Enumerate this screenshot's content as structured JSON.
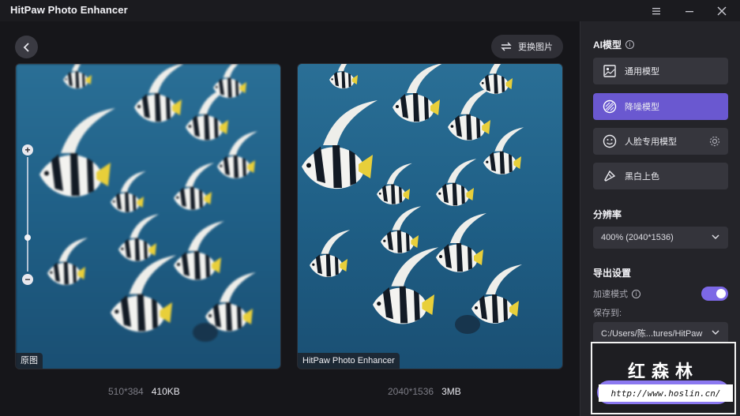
{
  "app": {
    "title": "HitPaw Photo Enhancer"
  },
  "toolbar": {
    "replace_label": "更换图片"
  },
  "images": {
    "original": {
      "tag": "原图",
      "dimensions": "510*384",
      "size": "410KB"
    },
    "enhanced": {
      "tag": "HitPaw Photo Enhancer",
      "dimensions": "2040*1536",
      "size": "3MB"
    }
  },
  "side": {
    "ai_model_title": "AI模型",
    "models": [
      {
        "label": "通用模型",
        "icon": "image-icon",
        "active": false
      },
      {
        "label": "降噪模型",
        "icon": "denoise-icon",
        "active": true
      },
      {
        "label": "人脸专用模型",
        "icon": "face-icon",
        "active": false
      },
      {
        "label": "黑白上色",
        "icon": "colorize-icon",
        "active": false
      }
    ],
    "resolution_title": "分辨率",
    "resolution_value": "400% (2040*1536)",
    "export_title": "导出设置",
    "accel_label": "加速模式",
    "accel_on": true,
    "saveto_label": "保存到:",
    "saveto_path": "C:/Users/陈...tures/HitPaw"
  },
  "watermark": {
    "title": "红森林",
    "url": "http://www.hoslin.cn/"
  },
  "colors": {
    "accent": "#7c68e6",
    "active_model": "#6a58d0",
    "panel": "#242429"
  }
}
